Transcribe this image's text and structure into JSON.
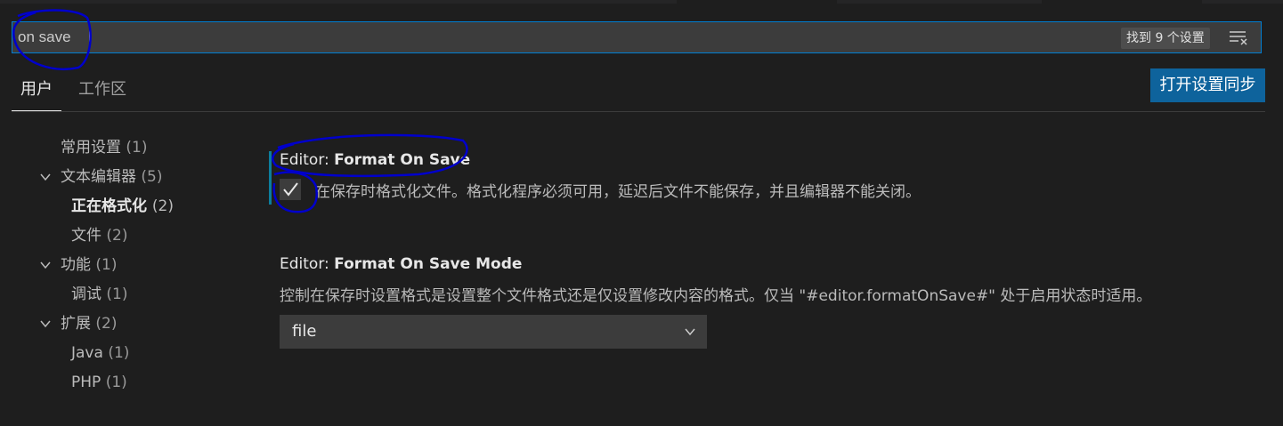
{
  "search": {
    "value": "on save",
    "result_count": "找到 9 个设置"
  },
  "icons": {
    "filter": "filter-list-icon",
    "chevron": "chevron-down-icon",
    "check": "check-icon"
  },
  "scopes": {
    "user_tab": "用户",
    "workspace_tab": "工作区",
    "sync_button": "打开设置同步"
  },
  "toc": [
    {
      "label": "常用设置",
      "count": "(1)",
      "level": 0,
      "expandable": false
    },
    {
      "label": "文本编辑器",
      "count": "(5)",
      "level": 0,
      "expandable": true
    },
    {
      "label": "正在格式化",
      "count": "(2)",
      "level": 1,
      "selected": true
    },
    {
      "label": "文件",
      "count": "(2)",
      "level": 1
    },
    {
      "label": "功能",
      "count": "(1)",
      "level": 0,
      "expandable": true
    },
    {
      "label": "调试",
      "count": "(1)",
      "level": 1
    },
    {
      "label": "扩展",
      "count": "(2)",
      "level": 0,
      "expandable": true
    },
    {
      "label": "Java",
      "count": "(1)",
      "level": 1
    },
    {
      "label": "PHP",
      "count": "(1)",
      "level": 1
    }
  ],
  "settings": [
    {
      "category": "Editor: ",
      "name": "Format On Save",
      "checked": true,
      "description": "在保存时格式化文件。格式化程序必须可用，延迟后文件不能保存，并且编辑器不能关闭。"
    },
    {
      "category": "Editor: ",
      "name": "Format On Save Mode",
      "description": "控制在保存时设置格式是设置整个文件格式还是仅设置修改内容的格式。仅当 \"#editor.formatOnSave#\" 处于启用状态时适用。",
      "selected_value": "file"
    }
  ],
  "colors": {
    "accent": "#007fd4",
    "button": "#0e639c",
    "annotation": "#0000cc"
  }
}
